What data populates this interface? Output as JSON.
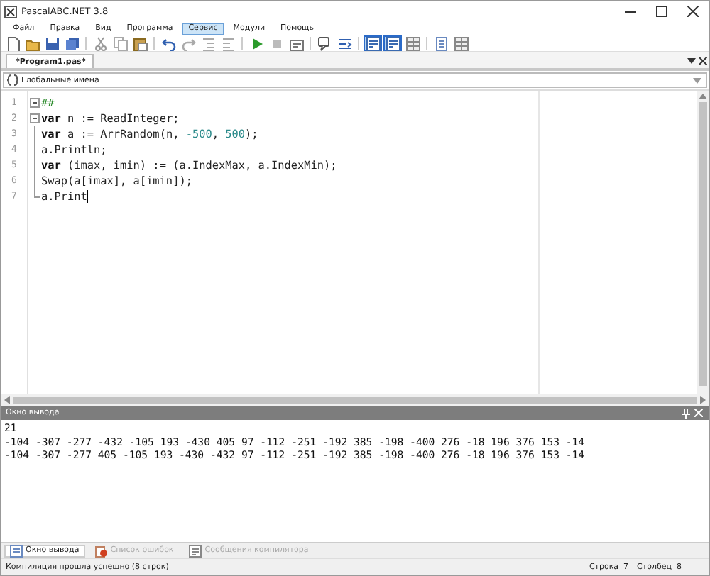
{
  "window": {
    "title": "PascalABC.NET 3.8"
  },
  "menu": [
    {
      "label": "Файл",
      "selected": false
    },
    {
      "label": "Правка",
      "selected": false
    },
    {
      "label": "Вид",
      "selected": false
    },
    {
      "label": "Программа",
      "selected": false
    },
    {
      "label": "Сервис",
      "selected": true
    },
    {
      "label": "Модули",
      "selected": false
    },
    {
      "label": "Помощь",
      "selected": false
    }
  ],
  "toolbar": [
    [
      {
        "kind": "new",
        "pressed": false
      },
      {
        "kind": "open",
        "pressed": false
      },
      {
        "kind": "save",
        "pressed": false
      },
      {
        "kind": "saveall",
        "pressed": false
      }
    ],
    [
      {
        "kind": "cut",
        "pressed": false
      },
      {
        "kind": "copy",
        "pressed": false
      },
      {
        "kind": "paste",
        "pressed": false
      }
    ],
    [
      {
        "kind": "undo",
        "pressed": false
      },
      {
        "kind": "redo",
        "pressed": false
      },
      {
        "kind": "indent",
        "pressed": false
      },
      {
        "kind": "outdent",
        "pressed": false
      }
    ],
    [
      {
        "kind": "run",
        "pressed": false
      },
      {
        "kind": "stop",
        "pressed": false
      },
      {
        "kind": "debug",
        "pressed": false
      }
    ],
    [
      {
        "kind": "comment",
        "pressed": false
      },
      {
        "kind": "format",
        "pressed": false
      }
    ],
    [
      {
        "kind": "panel",
        "pressed": true
      },
      {
        "kind": "panel",
        "pressed": true
      },
      {
        "kind": "grid",
        "pressed": false
      }
    ],
    [
      {
        "kind": "page",
        "pressed": false
      },
      {
        "kind": "grid",
        "pressed": false
      }
    ]
  ],
  "file_tab": {
    "label": "*Program1.pas*",
    "selected": true
  },
  "names_dropdown": {
    "value": "Глобальные имена"
  },
  "editor": {
    "lines": [
      {
        "number": "1",
        "segments": [
          {
            "kind": "comment",
            "text": "##"
          }
        ]
      },
      {
        "number": "2",
        "segments": [
          {
            "kind": "keyword",
            "text": "var"
          },
          {
            "kind": "plain",
            "text": " n := ReadInteger;"
          }
        ]
      },
      {
        "number": "3",
        "segments": [
          {
            "kind": "keyword",
            "text": "var"
          },
          {
            "kind": "plain",
            "text": " a := ArrRandom(n, "
          },
          {
            "kind": "number",
            "text": "-500"
          },
          {
            "kind": "plain",
            "text": ", "
          },
          {
            "kind": "number",
            "text": "500"
          },
          {
            "kind": "plain",
            "text": ");"
          }
        ]
      },
      {
        "number": "4",
        "segments": [
          {
            "kind": "plain",
            "text": "a.Println;"
          }
        ]
      },
      {
        "number": "5",
        "segments": [
          {
            "kind": "keyword",
            "text": "var"
          },
          {
            "kind": "plain",
            "text": " (imax, imin) := (a.IndexMax, a.IndexMin);"
          }
        ]
      },
      {
        "number": "6",
        "segments": [
          {
            "kind": "plain",
            "text": "Swap(a[imax], a[imin]);"
          }
        ]
      },
      {
        "number": "7",
        "segments": [
          {
            "kind": "plain",
            "text": "a.Print"
          }
        ]
      }
    ]
  },
  "output": {
    "title": "Окно вывода",
    "lines": [
      "21",
      "-104 -307 -277 -432 -105 193 -430 405 97 -112 -251 -192 385 -198 -400 276 -18 196 376 153 -14",
      "-104 -307 -277 405 -105 193 -430 -432 97 -112 -251 -192 385 -198 -400 276 -18 196 376 153 -14"
    ]
  },
  "bottom_tabs": [
    {
      "label": "Окно вывода",
      "selected": true
    },
    {
      "label": "Список ошибок",
      "selected": false
    },
    {
      "label": "Сообщения компилятора",
      "selected": false
    }
  ],
  "status_bar": {
    "message": "Компиляция прошла успешно (8 строк)",
    "line": "Строка  7",
    "column": "Столбец  8"
  }
}
